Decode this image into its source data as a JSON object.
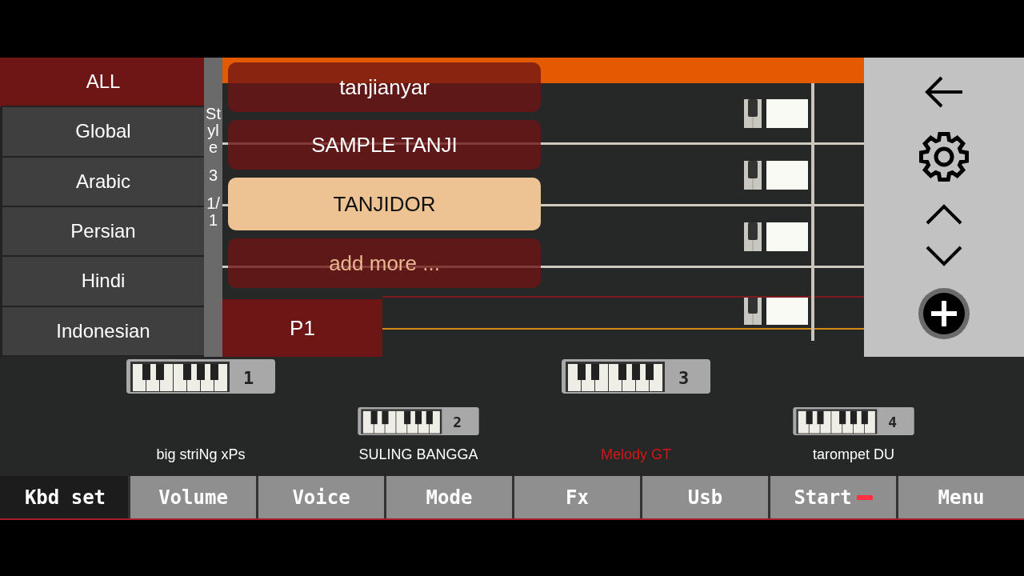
{
  "categories": [
    {
      "label": "ALL",
      "selected": true
    },
    {
      "label": "Global",
      "selected": false
    },
    {
      "label": "Arabic",
      "selected": false
    },
    {
      "label": "Persian",
      "selected": false
    },
    {
      "label": "Hindi",
      "selected": false
    },
    {
      "label": "Indonesian",
      "selected": false
    }
  ],
  "style_strip": [
    "Style",
    "3",
    "1/1"
  ],
  "styles": [
    {
      "label": "tanjianyar",
      "kind": "style",
      "selected": false
    },
    {
      "label": "SAMPLE TANJI",
      "kind": "style",
      "selected": false
    },
    {
      "label": "TANJIDOR",
      "kind": "style",
      "selected": true
    },
    {
      "label": "add more ...",
      "kind": "add",
      "selected": false
    }
  ],
  "pattern": "P1",
  "voices": [
    {
      "number": "1",
      "name": "big striNg xPs",
      "color": "#ffffff"
    },
    {
      "number": "2",
      "name": "SULING BANGGA",
      "color": "#ffffff"
    },
    {
      "number": "3",
      "name": "Melody GT",
      "color": "#d01818"
    },
    {
      "number": "4",
      "name": "tarompet DU",
      "color": "#ffffff"
    }
  ],
  "tabs": [
    {
      "label": "Kbd set",
      "selected": true
    },
    {
      "label": "Volume",
      "selected": false
    },
    {
      "label": "Voice",
      "selected": false
    },
    {
      "label": "Mode",
      "selected": false
    },
    {
      "label": "Fx",
      "selected": false
    },
    {
      "label": "Usb",
      "selected": false
    },
    {
      "label": "Start",
      "selected": false,
      "kind": "record"
    },
    {
      "label": "Menu",
      "selected": false
    }
  ]
}
